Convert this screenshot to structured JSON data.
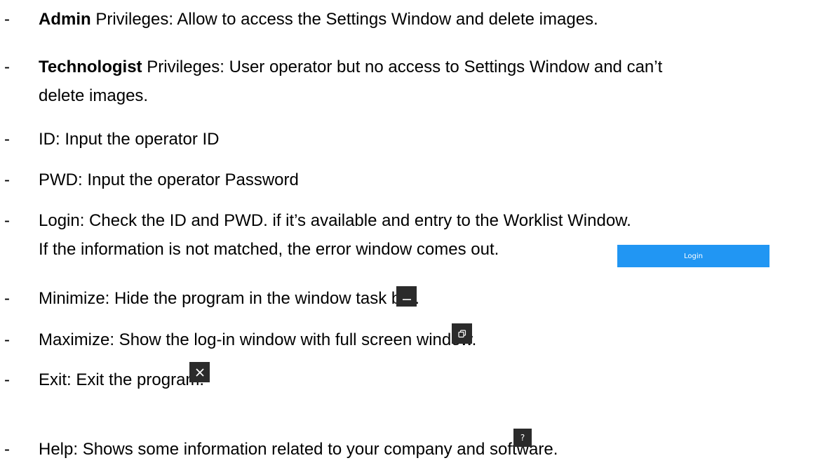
{
  "items": [
    {
      "bold": "Admin",
      "text": " Privileges: Allow to access the Settings Window and delete images."
    },
    {
      "bold": "Technologist",
      "text": " Privileges: User operator but no access to Settings Window and can’t",
      "cont": "delete images."
    },
    {
      "text": "ID: Input the operator ID"
    },
    {
      "text": "PWD: Input the operator Password"
    },
    {
      "text": "Login: Check the ID and PWD. if it’s available and entry to the Worklist Window.",
      "cont": "If the information is not matched, the error window comes out."
    },
    {
      "text": "Minimize: Hide the program in the window task bar."
    },
    {
      "text": "Maximize: Show the log-in window with full screen window."
    },
    {
      "text": "Exit: Exit the program."
    },
    {
      "text": "Help: Shows some information related to your company and software."
    }
  ],
  "dash": "-",
  "login_button_label": "Login",
  "help_glyph": "?",
  "colors": {
    "login_button": "#2196f3",
    "icon_button_bg": "#2b2b2b",
    "icon_fg": "#ffffff"
  },
  "icons": [
    "minimize-icon",
    "restore-icon",
    "close-icon",
    "help-icon"
  ]
}
